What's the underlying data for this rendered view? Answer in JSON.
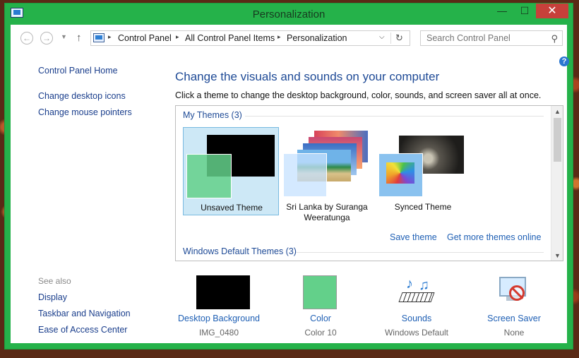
{
  "window": {
    "title": "Personalization",
    "minimize": "—",
    "maximize": "☐",
    "close": "✕"
  },
  "address_bar": {
    "crumbs": [
      "Control Panel",
      "All Control Panel Items",
      "Personalization"
    ],
    "search_placeholder": "Search Control Panel"
  },
  "left_pane": {
    "home": "Control Panel Home",
    "links": [
      "Change desktop icons",
      "Change mouse pointers"
    ],
    "see_also_title": "See also",
    "see_also": [
      "Display",
      "Taskbar and Navigation",
      "Ease of Access Center"
    ]
  },
  "main": {
    "heading": "Change the visuals and sounds on your computer",
    "subtext": "Click a theme to change the desktop background, color, sounds, and screen saver all at once.",
    "my_themes_label": "My Themes (3)",
    "themes": [
      {
        "name": "Unsaved Theme",
        "selected": true
      },
      {
        "name": "Sri Lanka by Suranga Weeratunga",
        "selected": false
      },
      {
        "name": "Synced Theme",
        "selected": false
      }
    ],
    "save_theme": "Save theme",
    "get_more": "Get more themes online",
    "default_themes_label": "Windows Default Themes (3)"
  },
  "bottom": [
    {
      "label": "Desktop Background",
      "value": "IMG_0480",
      "icon": "desktop-background-icon"
    },
    {
      "label": "Color",
      "value": "Color 10",
      "icon": "color-icon"
    },
    {
      "label": "Sounds",
      "value": "Windows Default",
      "icon": "sounds-icon"
    },
    {
      "label": "Screen Saver",
      "value": "None",
      "icon": "screen-saver-icon"
    }
  ],
  "colors": {
    "window_frame": "#25b24a",
    "accent_link": "#1e5fb4",
    "selected_theme": "#cde8f6",
    "theme_color_swatch": "#63d08a"
  }
}
